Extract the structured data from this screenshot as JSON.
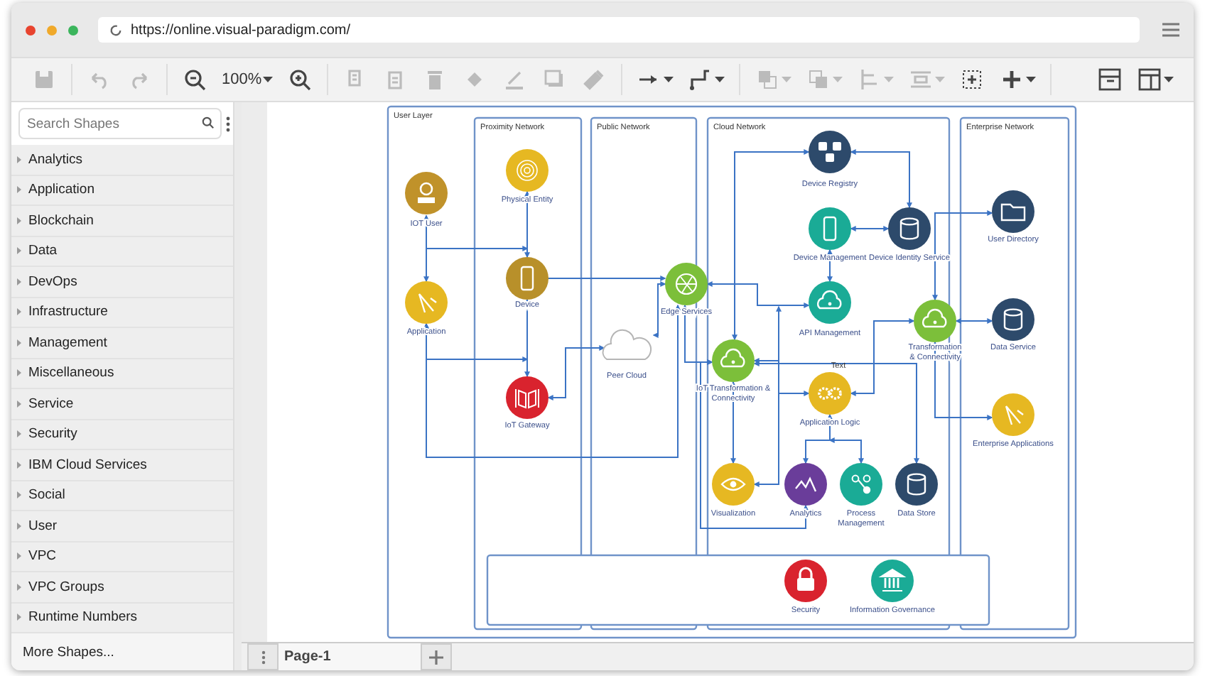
{
  "browser": {
    "url": "https://online.visual-paradigm.com/"
  },
  "toolbar": {
    "groups": [
      [
        {
          "kind": "save",
          "disabled": true
        }
      ],
      [
        {
          "kind": "undo",
          "disabled": true
        },
        {
          "kind": "redo",
          "disabled": true
        }
      ],
      [
        {
          "kind": "zoom-out",
          "disabled": false
        },
        {
          "kind": "zoom-level",
          "label": "100%",
          "disabled": false
        },
        {
          "kind": "zoom-in",
          "disabled": false
        }
      ],
      [
        {
          "kind": "copy",
          "disabled": true
        },
        {
          "kind": "paste",
          "disabled": true
        },
        {
          "kind": "delete",
          "disabled": true
        },
        {
          "kind": "fill",
          "disabled": true
        },
        {
          "kind": "line",
          "disabled": true
        },
        {
          "kind": "shadow",
          "disabled": true
        },
        {
          "kind": "format",
          "disabled": true
        }
      ],
      [
        {
          "kind": "connector",
          "disabled": false
        },
        {
          "kind": "waypoint",
          "disabled": false
        }
      ],
      [
        {
          "kind": "to-front",
          "disabled": true
        },
        {
          "kind": "to-back",
          "disabled": true
        },
        {
          "kind": "align",
          "disabled": true
        },
        {
          "kind": "distribute",
          "disabled": true
        },
        {
          "kind": "select-all",
          "disabled": false
        },
        {
          "kind": "insert",
          "disabled": false
        }
      ]
    ],
    "right": [
      {
        "kind": "panel",
        "disabled": false
      },
      {
        "kind": "layout",
        "disabled": false
      }
    ]
  },
  "sidebar": {
    "search": {
      "placeholder": "Search Shapes"
    },
    "categories": [
      {
        "label": "Analytics",
        "expanded": false
      },
      {
        "label": "Application",
        "expanded": false
      },
      {
        "label": "Blockchain",
        "expanded": false
      },
      {
        "label": "Data",
        "expanded": false
      },
      {
        "label": "DevOps",
        "expanded": false
      },
      {
        "label": "Infrastructure",
        "expanded": false
      },
      {
        "label": "Management",
        "expanded": false
      },
      {
        "label": "Miscellaneous",
        "expanded": false
      },
      {
        "label": "Service",
        "expanded": false
      },
      {
        "label": "Security",
        "expanded": false
      },
      {
        "label": "IBM Cloud Services",
        "expanded": false
      },
      {
        "label": "Social",
        "expanded": false
      },
      {
        "label": "User",
        "expanded": false
      },
      {
        "label": "VPC",
        "expanded": false
      },
      {
        "label": "VPC Groups",
        "expanded": false
      },
      {
        "label": "Runtime Numbers",
        "expanded": false
      }
    ],
    "more": "More Shapes..."
  },
  "diagram": {
    "containers": [
      {
        "title": "User Layer"
      },
      {
        "title": "Proximity Network"
      },
      {
        "title": "Public Network"
      },
      {
        "title": "Cloud Network"
      },
      {
        "title": "Enterprise Network"
      }
    ],
    "nodes": [
      {
        "label": "IOT User",
        "kind": "user",
        "color": "#c0922a"
      },
      {
        "label": "Application",
        "kind": "compass",
        "color": "#e6b822"
      },
      {
        "label": "Physical Entity",
        "kind": "target",
        "color": "#e6b822"
      },
      {
        "label": "Device",
        "kind": "phone",
        "color": "#b8902a"
      },
      {
        "label": "IoT Gateway",
        "kind": "gateway",
        "color": "#d9232e"
      },
      {
        "label": "Peer Cloud",
        "kind": "cloud-outline",
        "color": "#b5b5b5"
      },
      {
        "label": "Edge Services",
        "kind": "globe",
        "color": "#7cbf3a"
      },
      {
        "label": "Device Registry",
        "kind": "databases",
        "color": "#2d4a6b"
      },
      {
        "label": "Device Management",
        "kind": "phone",
        "color": "#1aab96"
      },
      {
        "label": "Device Identity Service",
        "kind": "database",
        "color": "#2d4a6b"
      },
      {
        "label": "API Management",
        "kind": "cloud-gears",
        "color": "#1aab96"
      },
      {
        "label": "IoT Transformation &\nConnectivity",
        "kind": "cloud",
        "color": "#7cbf3a"
      },
      {
        "label": "Application Logic",
        "kind": "gears",
        "color": "#e6b822"
      },
      {
        "label": "Transformation\n& Connectivity",
        "kind": "cloud",
        "color": "#7cbf3a"
      },
      {
        "label": "User Directory",
        "kind": "folder",
        "color": "#2d4a6b"
      },
      {
        "label": "Data Service",
        "kind": "database",
        "color": "#2d4a6b"
      },
      {
        "label": "Enterprise Applications",
        "kind": "compass",
        "color": "#e6b822"
      },
      {
        "label": "Visualization",
        "kind": "eye",
        "color": "#e6b822"
      },
      {
        "label": "Analytics",
        "kind": "chart",
        "color": "#6a3d9a"
      },
      {
        "label": "Process\nManagement",
        "kind": "nodes",
        "color": "#1aab96"
      },
      {
        "label": "Data Store",
        "kind": "database",
        "color": "#2d4a6b"
      },
      {
        "label": "Security",
        "kind": "lock",
        "color": "#d9232e"
      },
      {
        "label": "Information Governance",
        "kind": "building",
        "color": "#1aab96"
      }
    ],
    "text_label": "Text"
  },
  "pages": {
    "tabs": [
      {
        "label": "Page-1",
        "selected": true
      }
    ]
  }
}
